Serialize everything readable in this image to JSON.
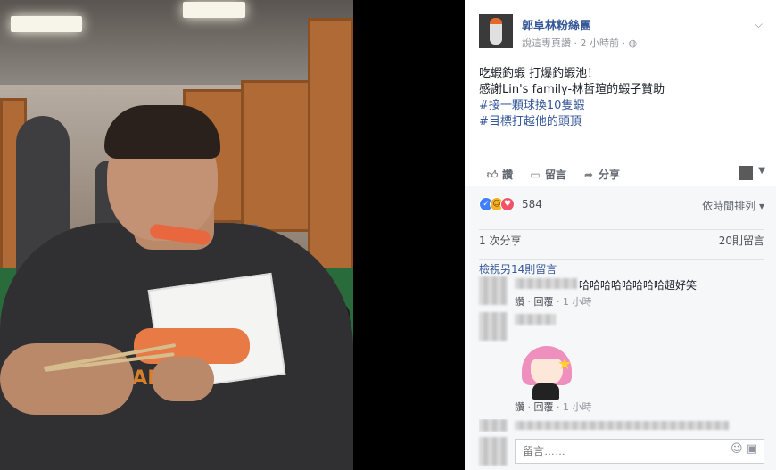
{
  "post": {
    "page_name": "郭阜林粉絲團",
    "meta_prefix": "說這專頁讚",
    "meta_separator": "·",
    "time": "2 小時前",
    "meta_suffix": "·",
    "audience_icon": "globe-icon",
    "options_icon": "chevron-down-icon",
    "lines": [
      "吃蝦釣蝦 打爆釣蝦池！",
      "感謝Lin's family-林哲瑄的蝦子贊助",
      "#接一顆球換10隻蝦",
      "#目標打越他的頭頂"
    ]
  },
  "actions": {
    "like": "讚",
    "comment": "留言",
    "share": "分享"
  },
  "reactions": {
    "count": "584",
    "icons": [
      "like-icon",
      "haha-icon",
      "love-icon"
    ],
    "sort_label": "依時間排列 ▾"
  },
  "stats": {
    "shares": "1 次分享",
    "comments": "20則留言"
  },
  "more_comments": "檢視另14則留言",
  "comments": [
    {
      "text": "哈哈哈哈哈哈哈哈超好笑",
      "like": "讚",
      "sep1": "·",
      "reply": "回覆",
      "sep2": "·",
      "time": "1 小時"
    },
    {
      "text": "",
      "like": "讚",
      "sep1": "·",
      "reply": "回覆",
      "sep2": "·",
      "time": "1 小時"
    }
  ],
  "comment_box": {
    "placeholder": "留言……",
    "icons": [
      "smiley-icon",
      "sticker-icon"
    ]
  },
  "colors": {
    "link": "#365899",
    "meta": "#90949c",
    "panel_bg": "#f6f7f9"
  }
}
